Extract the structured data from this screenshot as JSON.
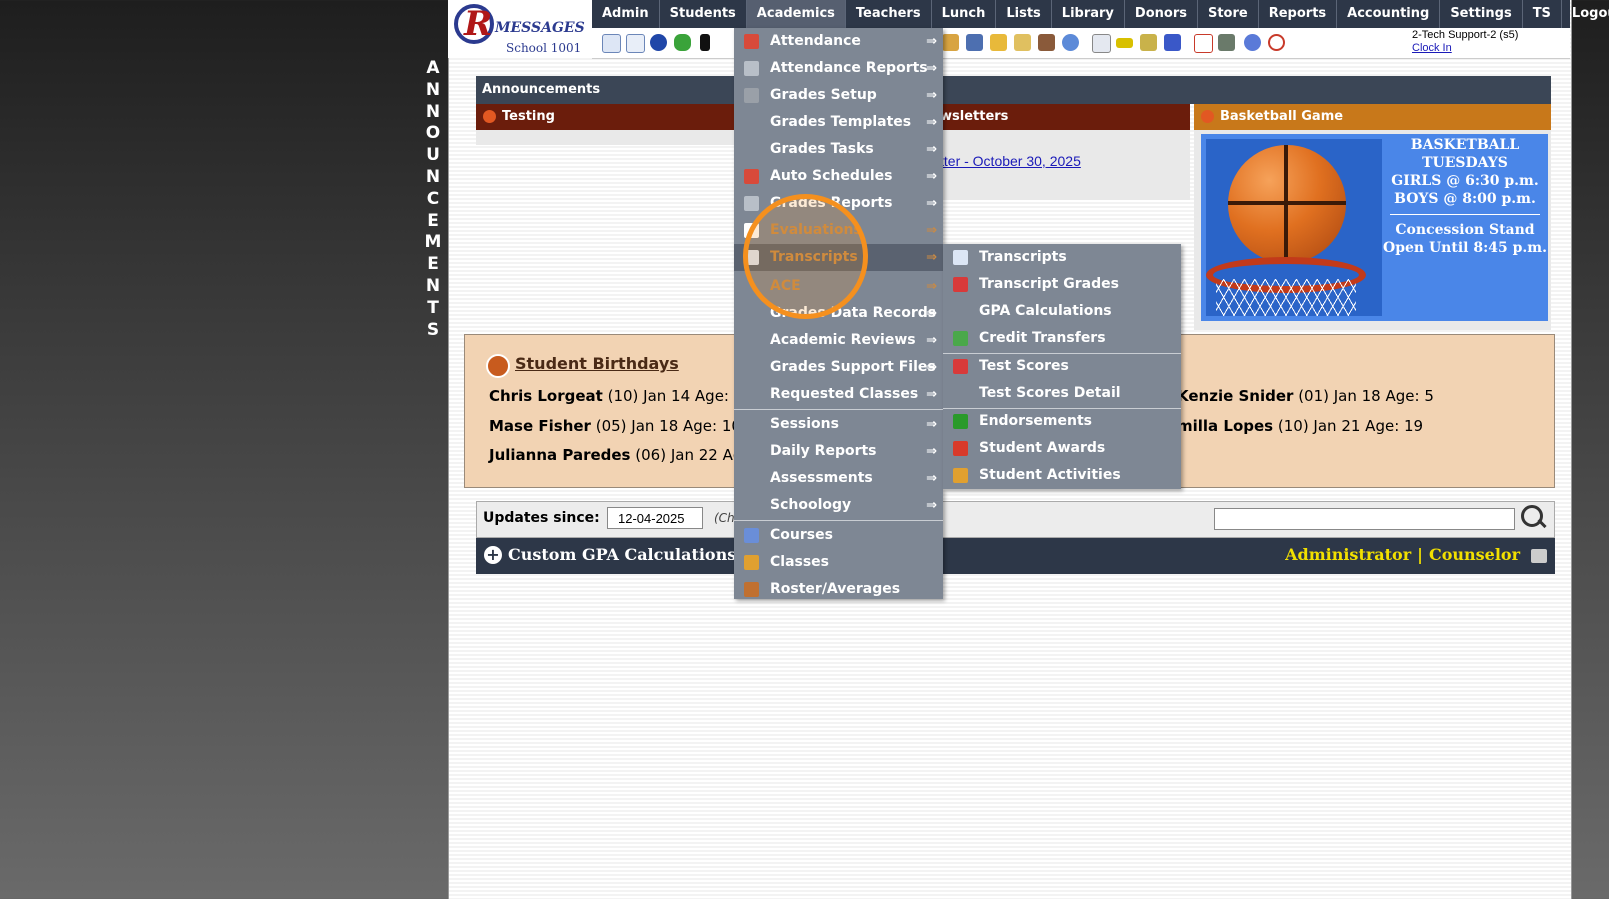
{
  "vertical_label": "ANNOUNCEMENTS",
  "logo": {
    "brand": "MESSAGES",
    "school": "School 1001"
  },
  "nav": [
    "Admin",
    "Students",
    "Academics",
    "Teachers",
    "Lunch",
    "Lists",
    "Library",
    "Donors",
    "Store",
    "Reports",
    "Accounting",
    "Settings",
    "TS",
    "Logout"
  ],
  "nav_active": "Academics",
  "user": {
    "name": "2-Tech Support-2 (s5)",
    "clock": "Clock In"
  },
  "announcements": {
    "title": "Announcements",
    "panes": [
      {
        "title": "Testing",
        "color": "#6b1d0c"
      },
      {
        "title": "Newsletters",
        "visible_fragment": "wsletters",
        "color": "#6b1d0c"
      },
      {
        "title": "Basketball Game",
        "color": "#c8781a"
      }
    ],
    "newsletter_link_fragment": "tter - October 30, 2025",
    "basketball": {
      "lines": [
        "BASKETBALL",
        "TUESDAYS",
        "GIRLS @ 6:30 p.m.",
        "BOYS  @ 8:00 p.m."
      ],
      "lines2": [
        "Concession Stand",
        "Open Until 8:45 p.m."
      ]
    }
  },
  "birthdays": {
    "title": "Student Birthdays",
    "entries": [
      {
        "name": "Chris Lorgeat",
        "detail": " (10) Jan 14 Age: 19"
      },
      {
        "name": "Mase Fisher",
        "detail": " (05) Jan 18 Age: 10"
      },
      {
        "name": "Julianna Paredes",
        "detail": " (06) Jan 22 Age:"
      },
      {
        "name": "Kenzie Snider",
        "visible_name": "Kenzie Snider",
        "detail": " (01) Jan 18 Age: 5"
      },
      {
        "name": "milla Lopes",
        "detail": " (10) Jan 21 Age: 19"
      }
    ]
  },
  "updates": {
    "label": "Updates since:",
    "date": "12-04-2025",
    "note": "(Ch"
  },
  "gpa_bar": {
    "title": "Custom GPA Calculations --",
    "role1": "Administrator",
    "separator": "|",
    "role2": "Counselor"
  },
  "academics_menu": [
    {
      "label": "Attendance",
      "icon": "calendar-icon",
      "sub": true
    },
    {
      "label": "Attendance Reports",
      "icon": "printer-icon",
      "sub": true
    },
    {
      "label": "Grades Setup",
      "icon": "gear-icon",
      "sub": true
    },
    {
      "label": "Grades Templates",
      "icon": "",
      "sub": true
    },
    {
      "label": "Grades Tasks",
      "icon": "",
      "sub": true
    },
    {
      "label": "Auto Schedules",
      "icon": "calendar-icon",
      "sub": true
    },
    {
      "label": "Grades Reports",
      "icon": "printer-icon",
      "sub": true
    },
    {
      "label": "Evaluations",
      "icon": "checkbox-icon",
      "sub": true
    },
    {
      "label": "Transcripts",
      "icon": "document-icon",
      "sub": true
    },
    {
      "label": "ACE",
      "icon": "",
      "sub": true
    },
    {
      "label": "Grades Data Records",
      "icon": "",
      "sub": true
    },
    {
      "label": "Academic Reviews",
      "icon": "",
      "sub": true
    },
    {
      "label": "Grades Support Files",
      "icon": "",
      "sub": true
    },
    {
      "label": "Requested Classes",
      "icon": "",
      "sub": true
    },
    {
      "label": "Sessions",
      "icon": "",
      "sub": true
    },
    {
      "label": "Daily Reports",
      "icon": "",
      "sub": true
    },
    {
      "label": "Assessments",
      "icon": "",
      "sub": true
    },
    {
      "label": "Schoology",
      "icon": "",
      "sub": true
    },
    {
      "label": "Courses",
      "icon": "book-icon",
      "sub": false
    },
    {
      "label": "Classes",
      "icon": "person-icon",
      "sub": false
    },
    {
      "label": "Roster/Averages",
      "icon": "roster-icon",
      "sub": false
    }
  ],
  "submenu_arrow": "⇒",
  "transcripts_submenu": [
    {
      "label": "Transcripts",
      "icon": "document-icon"
    },
    {
      "label": "Transcript Grades",
      "icon": "a-plus-icon"
    },
    {
      "label": "GPA Calculations",
      "icon": ""
    },
    {
      "label": "Credit Transfers",
      "icon": "transfer-icon"
    },
    {
      "label": "Test Scores",
      "icon": "a-plus-icon"
    },
    {
      "label": "Test Scores Detail",
      "icon": ""
    },
    {
      "label": "Endorsements",
      "icon": "checkmark-icon"
    },
    {
      "label": "Student Awards",
      "icon": "award-icon"
    },
    {
      "label": "Student Activities",
      "icon": "person-icon"
    }
  ],
  "colors": {
    "nav_bg": "#2d3748",
    "menu_bg": "#7e8794",
    "birthday_bg": "#f2d3b3",
    "highlight": "#f5901e",
    "roles": "#f2e000"
  }
}
